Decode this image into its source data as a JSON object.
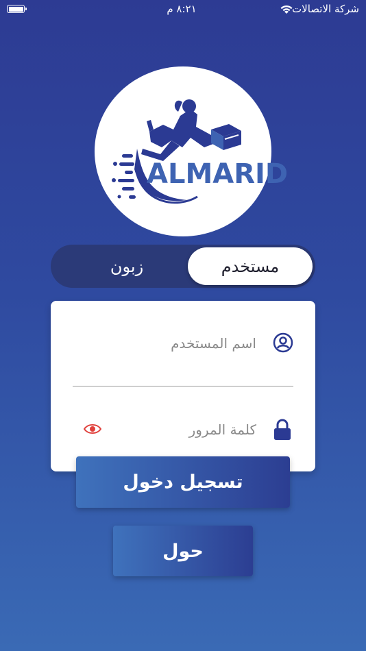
{
  "status_bar": {
    "carrier": "شركة الاتصالات",
    "time": "٨:٢١ م",
    "icons": [
      "battery-icon",
      "wifi-icon"
    ]
  },
  "logo": {
    "text": "ALMARID",
    "icon": "delivery-runner-logo"
  },
  "toggle": {
    "active_label": "مستخدم",
    "inactive_label": "زبون"
  },
  "form": {
    "username_placeholder": "اسم المستخدم",
    "username_value": "",
    "password_placeholder": "كلمة المرور",
    "password_value": "",
    "icons": [
      "user-icon",
      "lock-icon",
      "eye-icon"
    ]
  },
  "buttons": {
    "login_label": "تسجيل دخول",
    "about_label": "حول"
  },
  "colors": {
    "accent": "#2c3e92",
    "logo_blue": "#3e63b2",
    "eye_red": "#e0403c"
  }
}
